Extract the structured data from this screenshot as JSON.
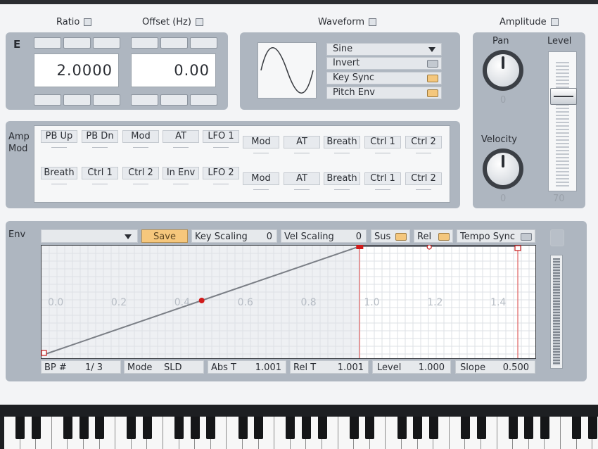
{
  "headers": {
    "ratio": "Ratio",
    "offset": "Offset (Hz)",
    "waveform": "Waveform",
    "amplitude": "Amplitude"
  },
  "operator": {
    "label": "E",
    "ratio_value": "2.0000",
    "offset_value": "0.00"
  },
  "waveform": {
    "selected": "Sine",
    "options": [
      {
        "label": "Invert",
        "checked": false
      },
      {
        "label": "Key Sync",
        "checked": true
      },
      {
        "label": "Pitch Env",
        "checked": true
      }
    ]
  },
  "amplitude": {
    "pan_label": "Pan",
    "pan_value": "0",
    "velocity_label": "Velocity",
    "velocity_value": "0",
    "level_label": "Level",
    "level_value": "70",
    "level_fraction": 0.7
  },
  "amp_mod": {
    "label_line1": "Amp",
    "label_line2": "Mod",
    "row1_left": [
      "PB Up",
      "PB Dn",
      "Mod",
      "AT",
      "LFO 1"
    ],
    "row2_left": [
      "Breath",
      "Ctrl 1",
      "Ctrl 2",
      "In Env",
      "LFO 2"
    ],
    "row1_right": [
      "Mod",
      "AT",
      "Breath",
      "Ctrl 1",
      "Ctrl 2"
    ],
    "row2_right": [
      "Mod",
      "AT",
      "Breath",
      "Ctrl 1",
      "Ctrl 2"
    ]
  },
  "env": {
    "label": "Env",
    "save_label": "Save",
    "key_scaling_label": "Key Scaling",
    "key_scaling_value": "0",
    "vel_scaling_label": "Vel Scaling",
    "vel_scaling_value": "0",
    "sus_label": "Sus",
    "rel_label": "Rel",
    "tempo_sync_label": "Tempo Sync",
    "time_ticks": [
      "0.0",
      "0.2",
      "0.4",
      "0.6",
      "0.8",
      "1.0",
      "1.2",
      "1.4"
    ],
    "breakpoints": [
      {
        "t": 0.0,
        "level": 0.0
      },
      {
        "t": 0.5,
        "level": 0.5
      },
      {
        "t": 1.0,
        "level": 1.0
      }
    ],
    "markers": [
      1.0,
      1.5
    ],
    "footer": {
      "bp_label": "BP #",
      "bp_value": "1/ 3",
      "mode_label": "Mode",
      "mode_value": "SLD",
      "abs_t_label": "Abs T",
      "abs_t_value": "1.001",
      "rel_t_label": "Rel T",
      "rel_t_value": "1.001",
      "level_label": "Level",
      "level_value": "1.000",
      "slope_label": "Slope",
      "slope_value": "0.500"
    }
  },
  "colors": {
    "panel": "#aeb6c0",
    "accent_orange": "#f4c77d",
    "envelope_point": "#d11a1a"
  }
}
